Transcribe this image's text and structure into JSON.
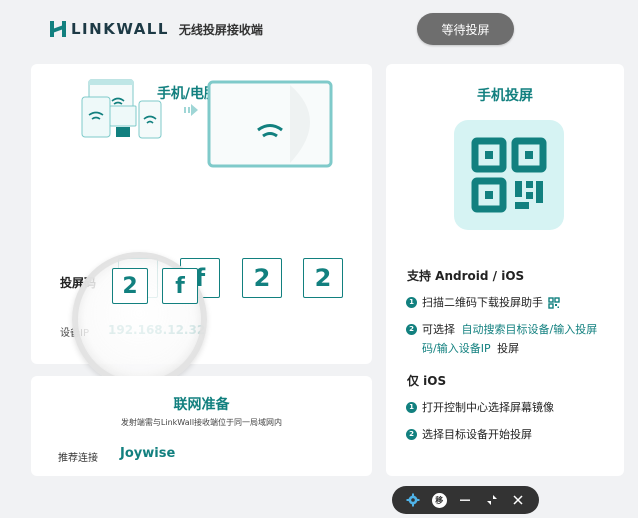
{
  "header": {
    "brand": "LINKWALL",
    "subtitle": "无线投屏接收端",
    "status_button": "等待投屏"
  },
  "left_card": {
    "title": "手机/电脑投屏",
    "code_label": "投屏码",
    "code_digits": [
      "2",
      "f",
      "2",
      "2"
    ],
    "ip_label": "设备IP",
    "ip_value": "192.168.12.32"
  },
  "magnifier": {
    "digits": [
      "2",
      "f"
    ]
  },
  "network_card": {
    "title": "联网准备",
    "description": "发射端需与LinkWall接收端位于同一局域网内",
    "recommend_label": "推荐连接",
    "recommend_value": "Joywise"
  },
  "right_card": {
    "title": "手机投屏",
    "android_heading": "支持 Android / iOS",
    "android_step1_num": "1",
    "android_step1": "扫描二维码下载投屏助手",
    "android_step2_num": "2",
    "android_step2_prefix": "可选择",
    "android_step2_link_line1": "自动搜索目标设备/输入投屏",
    "android_step2_link_line2": "码/输入设备IP",
    "android_step2_suffix": "投屏",
    "ios_heading": "仅 iOS",
    "ios_step1_num": "1",
    "ios_step1": "打开控制中心选择屏幕镜像",
    "ios_step2_num": "2",
    "ios_step2": "选择目标设备开始投屏"
  },
  "toolbar": {
    "move_label": "移"
  },
  "colors": {
    "accent": "#12807f",
    "qr_tile": "#d6f3f3",
    "status_button": "#6e6e6e",
    "toolbar": "#333333"
  }
}
